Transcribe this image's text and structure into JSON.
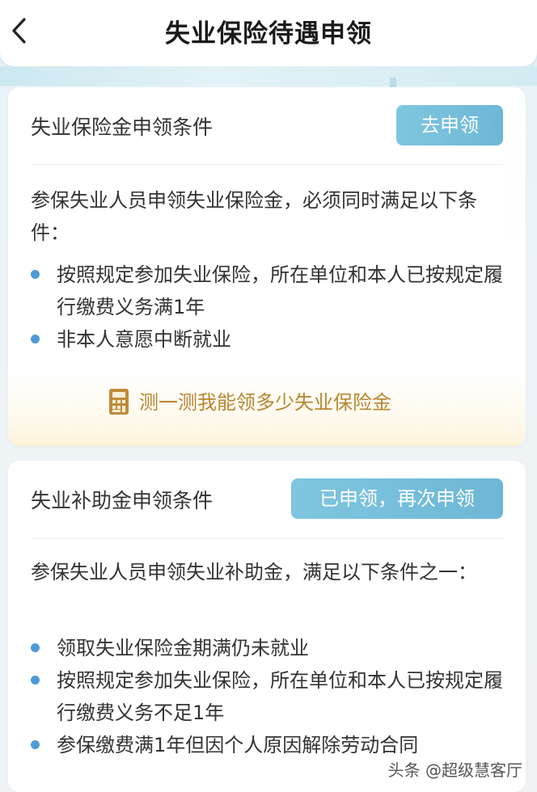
{
  "header": {
    "title": "失业保险待遇申领",
    "back_icon": "chevron-left-icon"
  },
  "card1": {
    "title": "失业保险金申领条件",
    "button_label": "去申领",
    "intro": "参保失业人员申领失业保险金，必须同时满足以下条件：",
    "bullets": [
      "按照规定参加失业保险，所在单位和本人已按规定履行缴费义务满1年",
      "非本人意愿中断就业"
    ],
    "calc_link": "测一测我能领多少失业保险金",
    "calc_icon": "calculator-icon"
  },
  "card2": {
    "title": "失业补助金申领条件",
    "button_label": "已申领，再次申领",
    "intro": "参保失业人员申领失业补助金，满足以下条件之一：",
    "bullets": [
      "领取失业保险金期满仍未就业",
      "按照规定参加失业保险，所在单位和本人已按规定履行缴费义务不足1年",
      "参保缴费满1年但因个人原因解除劳动合同"
    ]
  },
  "watermark": "头条 @超级慧客厅",
  "colors": {
    "accent": "#6db7d6",
    "bullet": "#4f9ad6",
    "link": "#b8862f"
  }
}
